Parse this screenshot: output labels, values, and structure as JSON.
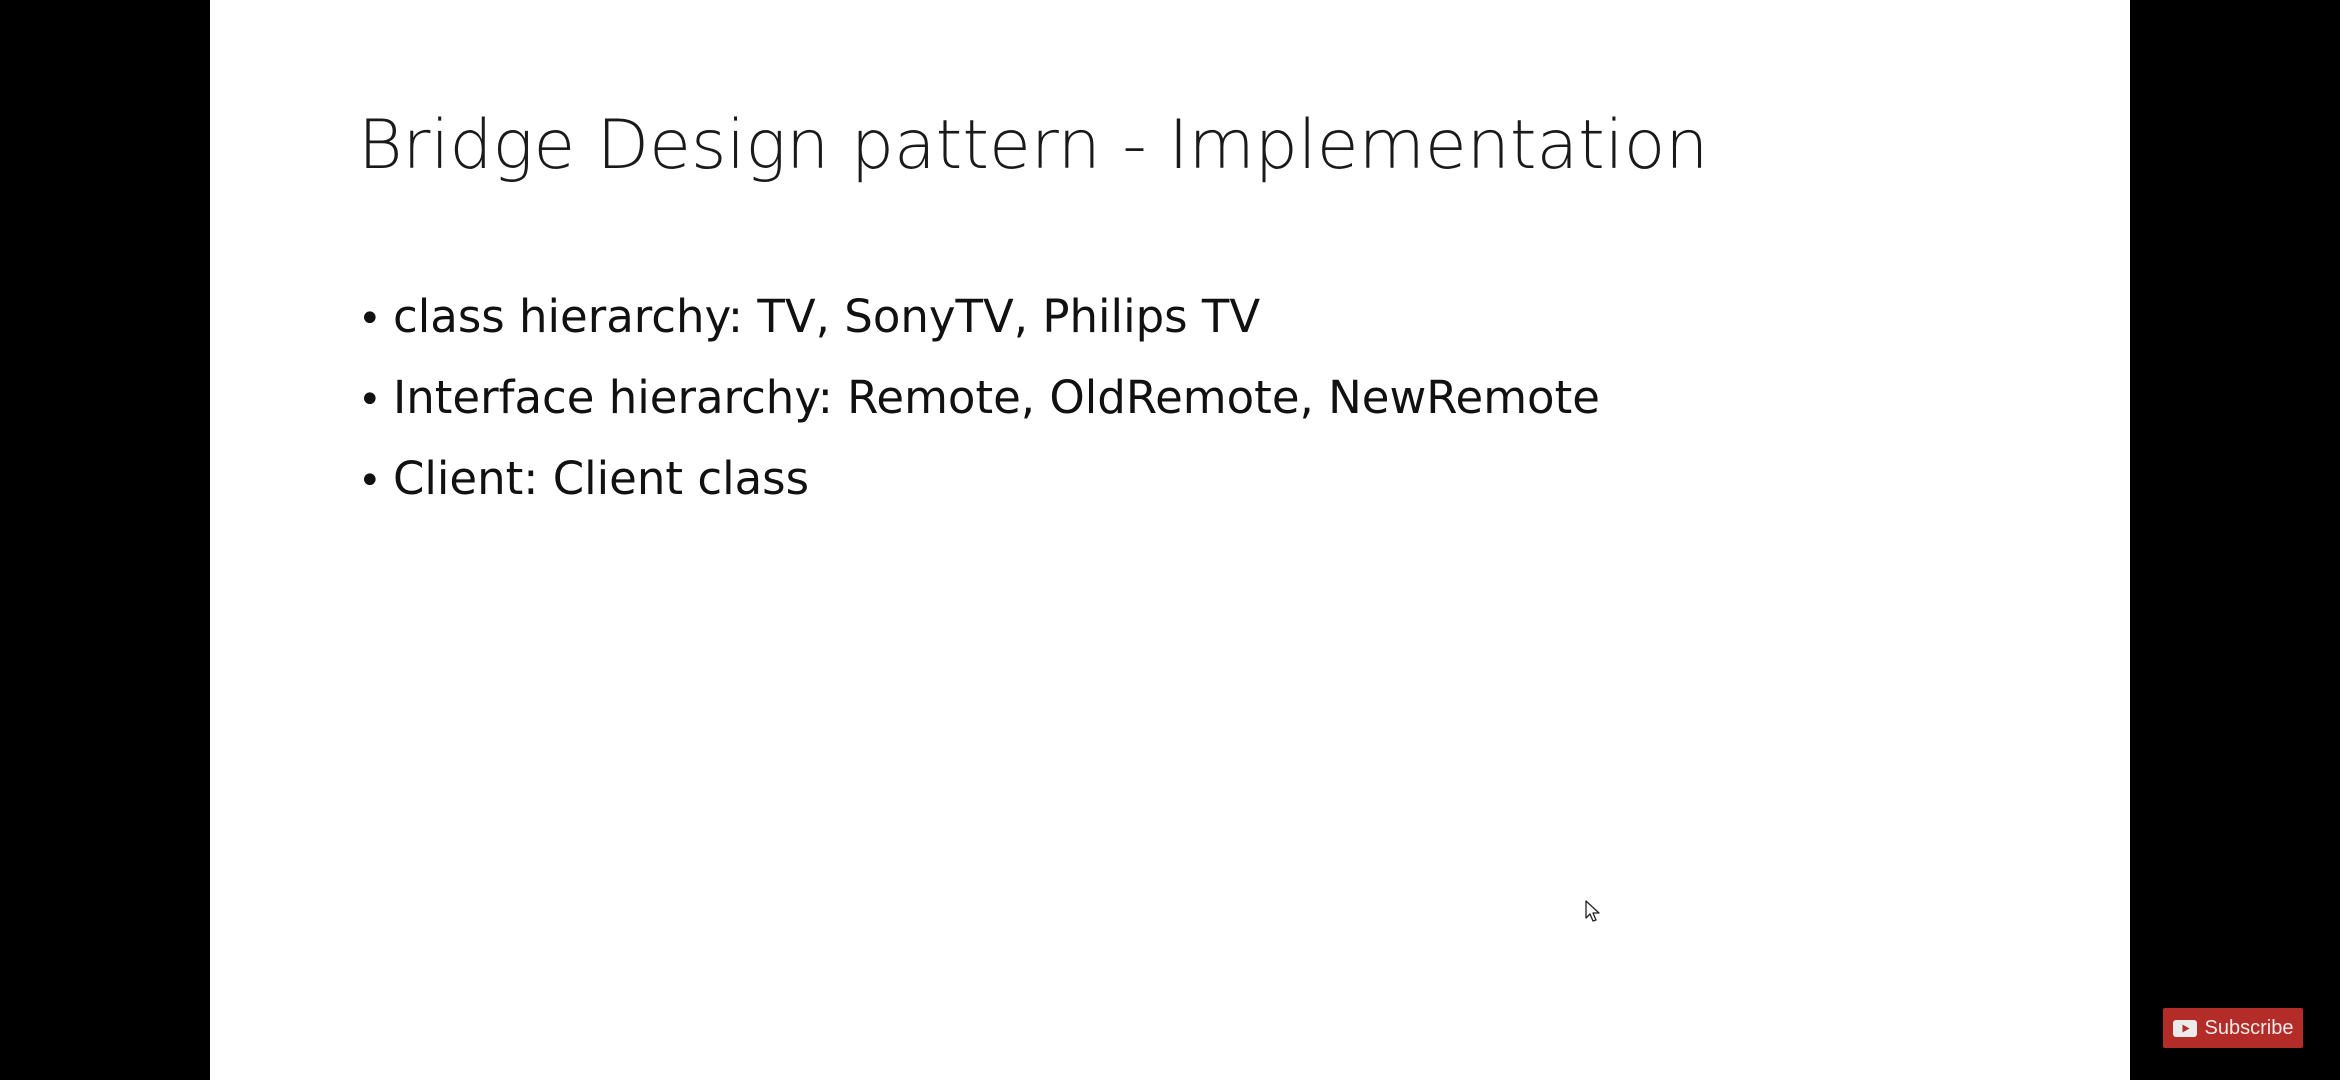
{
  "slide": {
    "title": "Bridge Design pattern - Implementation",
    "bullets": [
      {
        "marker": "•",
        "text": "class hierarchy: TV, SonyTV, Philips TV"
      },
      {
        "marker": "•",
        "text": "Interface hierarchy: Remote, OldRemote, NewRemote"
      },
      {
        "marker": "•",
        "text": "Client: Client class"
      }
    ]
  },
  "overlay": {
    "subscribe_label": "Subscribe",
    "subscribe_icon": "youtube-play-icon",
    "subscribe_color": "#c4302b"
  },
  "colors": {
    "letterbox": "#000000",
    "slide_background": "#ffffff",
    "text": "#111111"
  }
}
